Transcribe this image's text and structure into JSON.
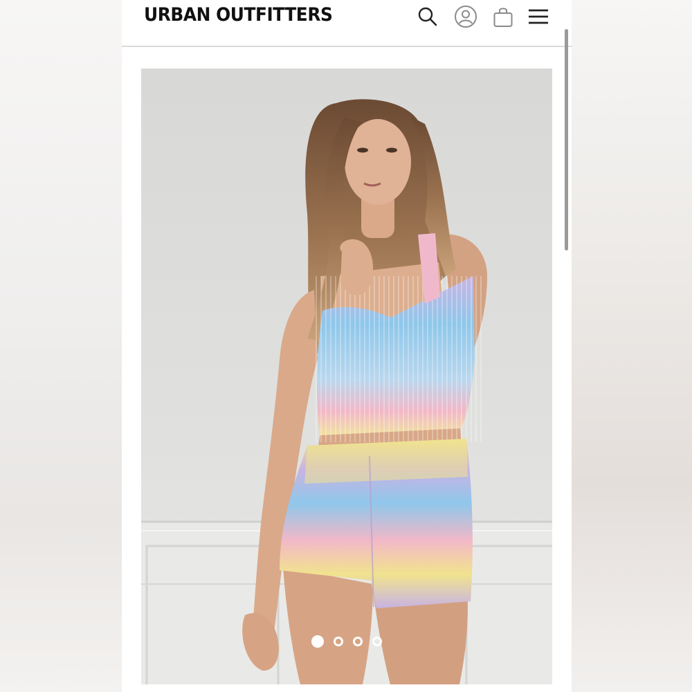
{
  "header": {
    "logo_text": "URBAN OUTFITTERS",
    "icons": [
      "search-icon",
      "account-icon",
      "shopping-bag-icon",
      "hamburger-menu-icon"
    ]
  },
  "product": {
    "image_subject": "model wearing pastel tie-dye ribbed knit crop top and shorts set"
  },
  "carousel": {
    "total_slides": 4,
    "active_slide": 1
  },
  "colors": {
    "header_background": "#ffffff",
    "logo": "#111111",
    "icon_stroke": "#222222",
    "icon_muted": "#8a8a8a",
    "knit_blue": "#8fc7ea",
    "knit_pink": "#f2b8c8",
    "knit_yellow": "#f1e38e",
    "knit_lilac": "#c8b3e3"
  }
}
